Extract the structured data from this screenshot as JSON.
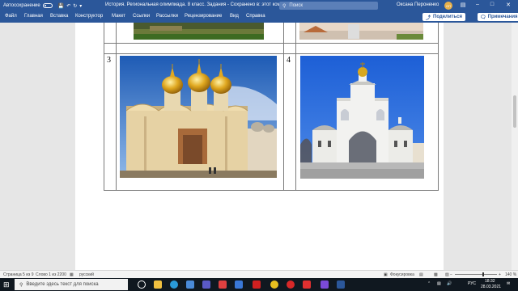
{
  "titlebar": {
    "autosave_label": "Автосохранение",
    "autosave_state": "off",
    "doc_title": "История. Региональная олимпиада. 8 класс. Задания  -  Сохранено в: этот компьютер",
    "search_placeholder": "Поиск",
    "user_name": "Оксана Пероненко",
    "user_initials": "ОП"
  },
  "ribbon": {
    "tabs": [
      "Файл",
      "Главная",
      "Вставка",
      "Конструктор",
      "Макет",
      "Ссылки",
      "Рассылки",
      "Рецензирование",
      "Вид",
      "Справка"
    ],
    "share_label": "Поделиться",
    "comments_label": "Примечания"
  },
  "document": {
    "cells": [
      {
        "number": "3",
        "image": "cathedral-with-golden-domes"
      },
      {
        "number": "4",
        "image": "white-gate-tower-blue-sky"
      }
    ]
  },
  "statusbar": {
    "page": "Страница 5 из 9",
    "words": "Слово 1 из 2200",
    "language": "русский",
    "focus": "Фокусировка",
    "zoom": "140 %"
  },
  "taskbar": {
    "search_placeholder": "Введите здесь текст для поиска",
    "lang": "РУС",
    "time": "18:32",
    "date": "28.03.2021"
  },
  "colors": {
    "accent": "#2b579a",
    "taskbar": "#101820"
  }
}
